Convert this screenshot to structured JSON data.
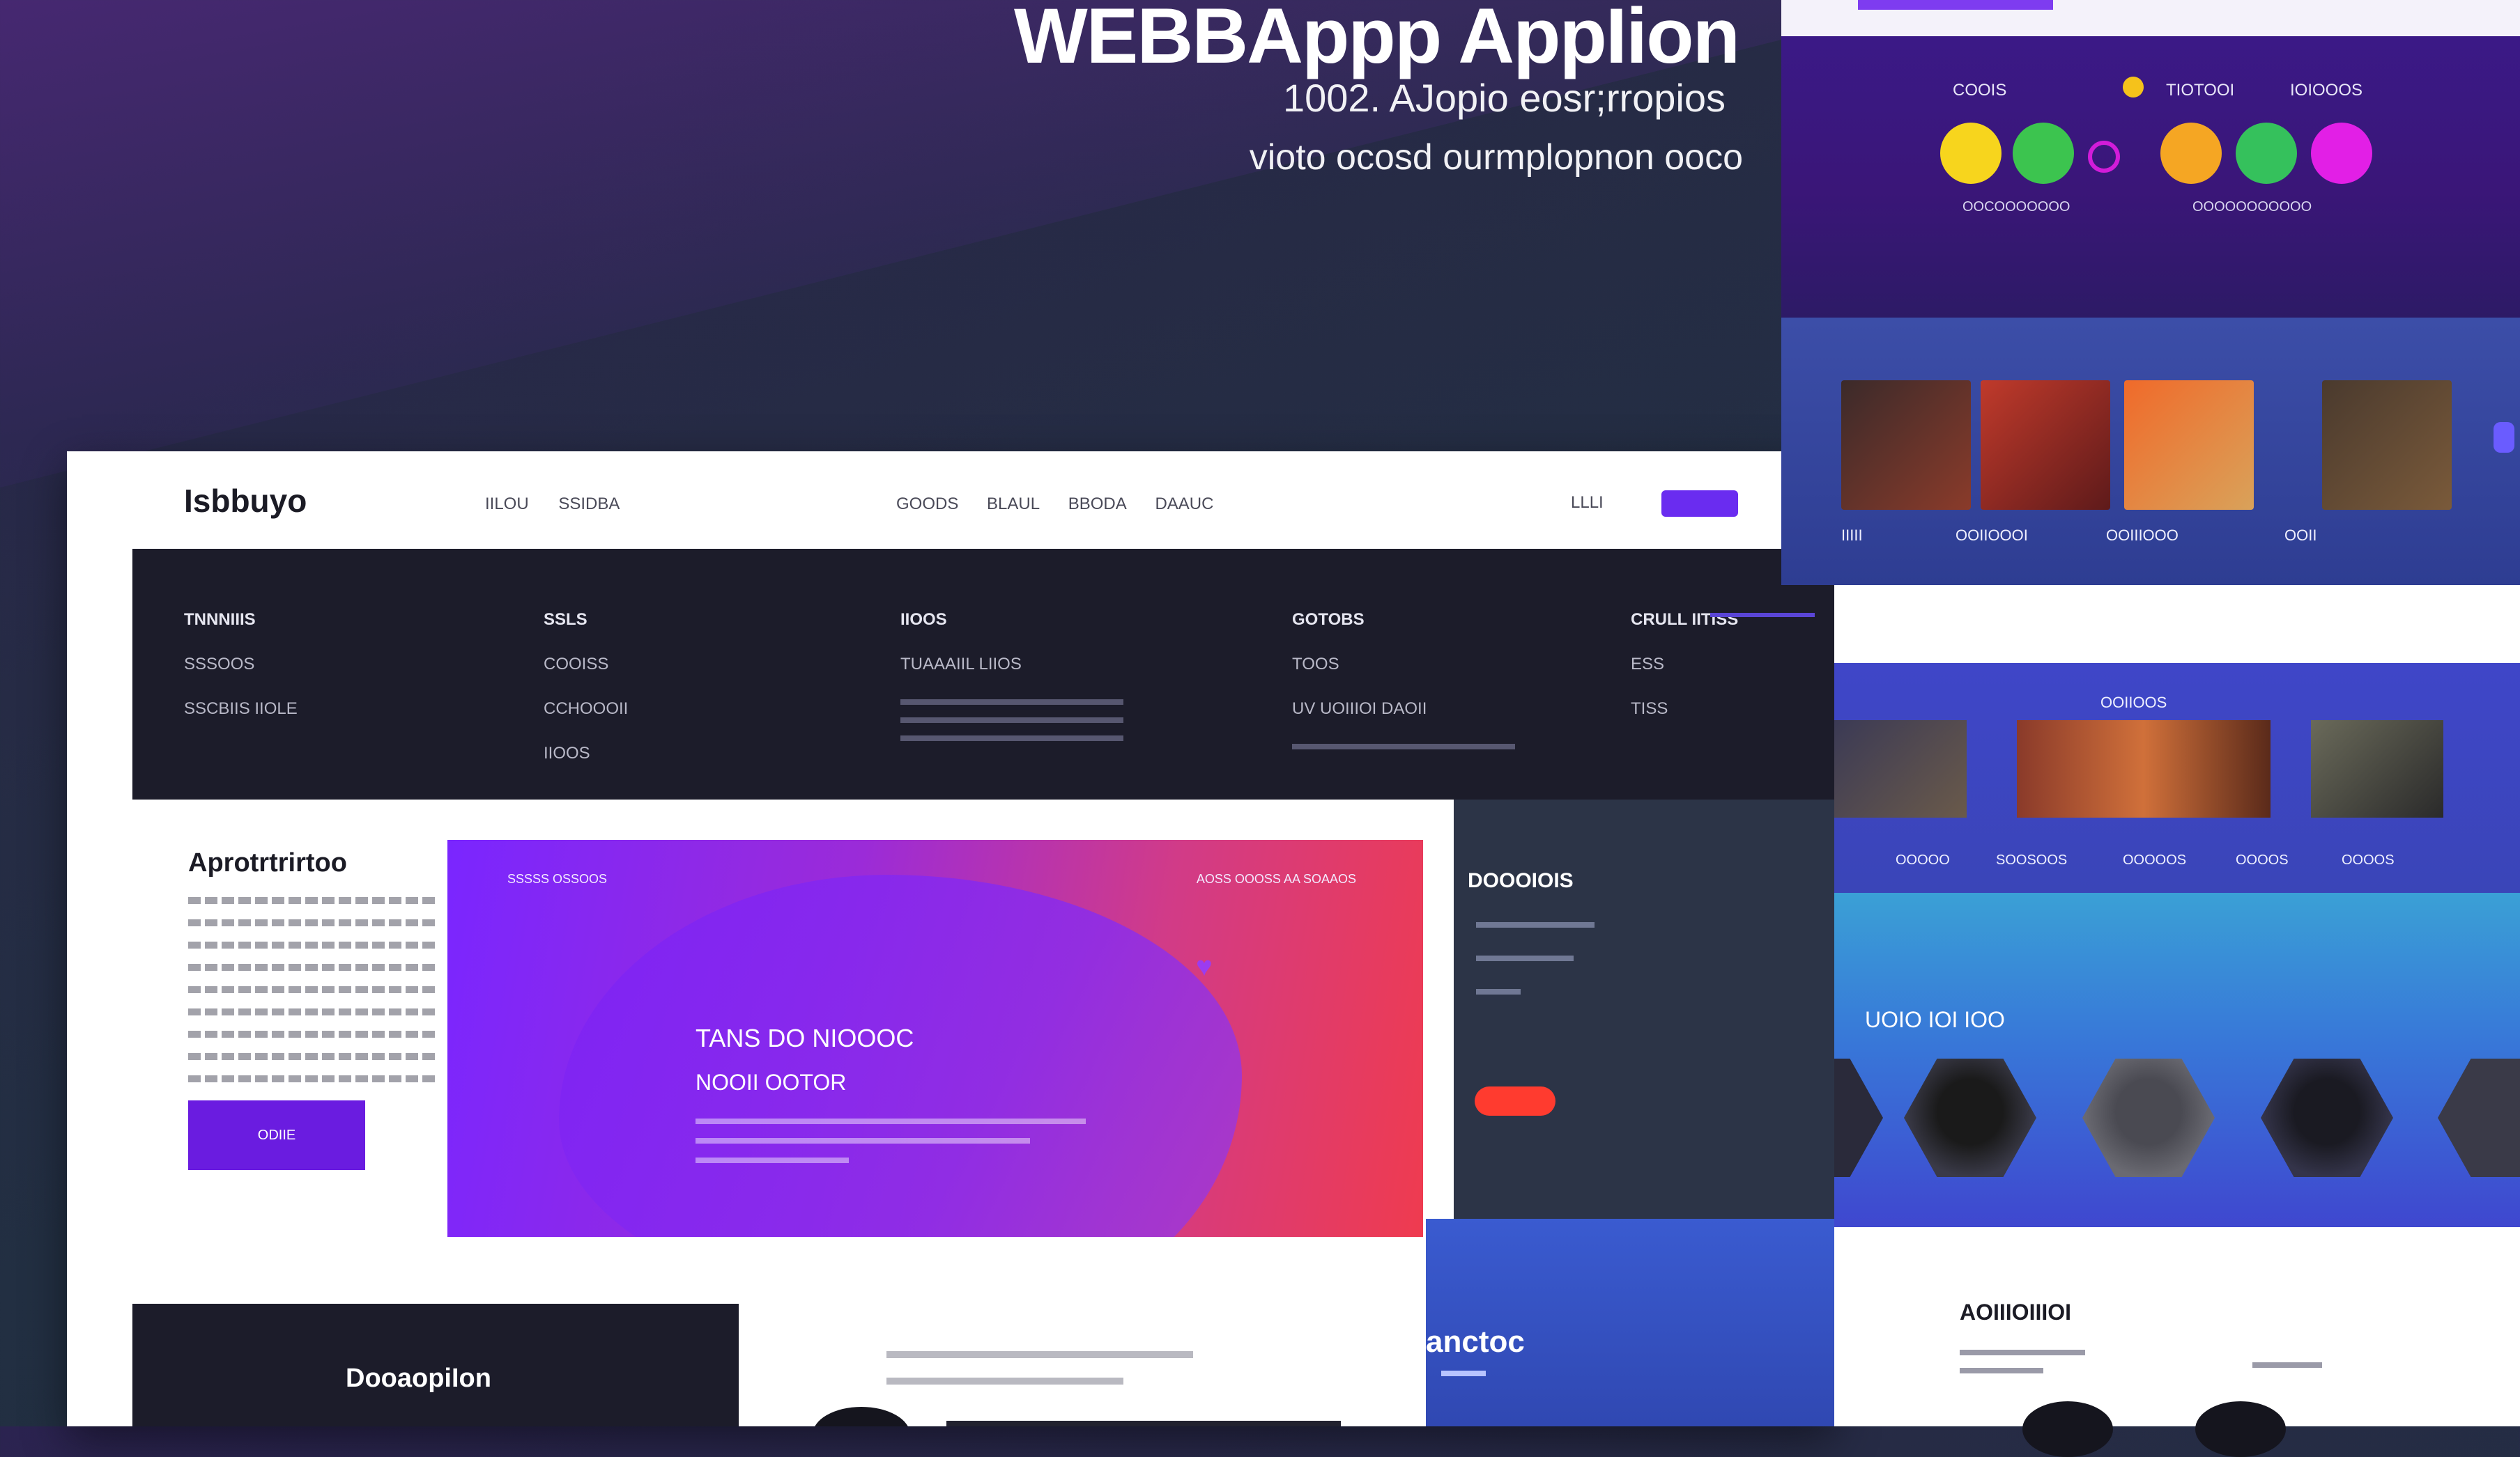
{
  "hero": {
    "title": "WEBBAppp AppIion",
    "subtitle_1": "1002. AJopio  eosr;rropios",
    "subtitle_2": "vioto ocosd ourmplopnon ooco"
  },
  "mock": {
    "logo": "Isbbuyo",
    "nav_left": [
      "IILOU",
      "SSIDBA"
    ],
    "nav_mid": [
      "GOODS",
      "BLAUL",
      "BBODA",
      "DAAUC"
    ],
    "nav_login": "LLLI",
    "nav_cta": "",
    "mega_menu": {
      "col1": [
        "TNNNIIIS",
        "SSSOOS",
        "SSCBIIS   IIOLE"
      ],
      "col2": [
        "SSLS",
        "COOISS",
        "CCHOOOII",
        "IIOOS"
      ],
      "col3": [
        "IIOOS",
        "TUAAAIIL LIIOS"
      ],
      "col4": [
        "GOTOBS",
        "TOOS",
        "UV UOIIIOI DAOII"
      ],
      "col5": [
        "CRULL IITISS",
        "ESS",
        "TISS"
      ]
    },
    "about": {
      "title": "Aprotrtrirtoo",
      "button": "ODIIE"
    },
    "hero_card": {
      "tag_left": "SSSSS OSSOOS",
      "tag_right": "AOSS OOOSS AA SOAAOS",
      "title_1": "TANS DO NIOOOC",
      "title_2": "NOOII OOTOR"
    },
    "side": {
      "title": "DOOOIOIS",
      "button": ""
    },
    "bottom_dark_title": "DooaopiIon",
    "blue_band_title": "anctoc"
  },
  "right_screens": {
    "row1_labels": [
      "COOIS",
      "TIOTOOI",
      "IOIOOOS"
    ],
    "row1_caps": [
      "OOCOOOOOOO",
      "OOOOOOOOOOO"
    ],
    "row2_caps": [
      "IIIII",
      "OOIIOOOI",
      "OOIIIOOO",
      "OOII"
    ],
    "banner_title": "OOIIOOS",
    "banner_nav": [
      "OOOOO",
      "SOOSOOS",
      "OOOOOS",
      "OOOOS",
      "OOOOS"
    ],
    "team_title": "UOIO IOI IOO",
    "footer_title": "AOIIIOIIIOI"
  },
  "colors": {
    "accent_purple": "#6a2cf0",
    "accent_red": "#ff3b2f",
    "dark_panel": "#1c1c2a"
  }
}
